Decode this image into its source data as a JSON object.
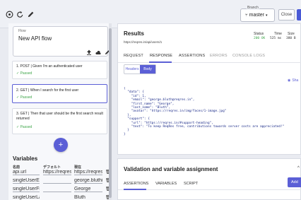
{
  "toolbar": {
    "branch_label": "Branch",
    "branch_value": "master",
    "close_label": "Close"
  },
  "flow": {
    "label": "Flow",
    "name": "New API flow"
  },
  "steps": [
    {
      "title": "1. POST | Given I'm an authenticated user",
      "status": "✓ Passed"
    },
    {
      "title": "2. GET | When I search for the first user",
      "status": "✓ Passed"
    },
    {
      "title": "3. GET | Then that user should be the first search result returned",
      "status": "✓ Passed"
    }
  ],
  "add_button": "+",
  "variables": {
    "title": "Variables",
    "headers": [
      "名前",
      "デフォルト",
      "現在"
    ],
    "rows": [
      {
        "name": "api.url",
        "default": "https://reqres",
        "current": "https://reqres"
      },
      {
        "name": "singleUserEma",
        "default": "",
        "current": "george.bluth("
      },
      {
        "name": "singleUserFirs",
        "default": "",
        "current": "George"
      },
      {
        "name": "singleUserLas",
        "default": "",
        "current": "Bluth"
      }
    ]
  },
  "results": {
    "title": "Results",
    "url": "https://reqres.in/api/users/1",
    "status_label": "Status",
    "status_value": "200 OK",
    "time_label": "Time",
    "time_value": "525 ms",
    "size_label": "Size",
    "size_value": "380 B",
    "tabs": [
      "REQUEST",
      "RESPONSE",
      "ASSERTIONS",
      "ERRORS",
      "CONSOLE LOGS"
    ],
    "toggle": [
      "Headers",
      "Body"
    ],
    "share_label": "Sha",
    "body": "{\n  \"data\": {\n    \"id\": 1,\n    \"email\": \"george.bluth@reqres.in\",\n    \"first_name\": \"George\",\n    \"last_name\": \"Bluth\",\n    \"avatar\": \"https://reqres.in/img/faces/1-image.jpg\"\n  },\n  \"support\": {\n    \"url\": \"https://reqres.in/#support-heading\",\n    \"text\": \"To keep ReqRes free, contributions towards server costs are appreciated!\"\n  }\n}"
  },
  "validation": {
    "title": "Validation and variable assignment",
    "tabs": [
      "ASSERTIONS",
      "VARIABLES",
      "SCRIPT"
    ],
    "add_label": "Add"
  },
  "colors": {
    "accent": "#5b5fd6",
    "success": "#3fa64a",
    "code": "#1a2a88"
  }
}
